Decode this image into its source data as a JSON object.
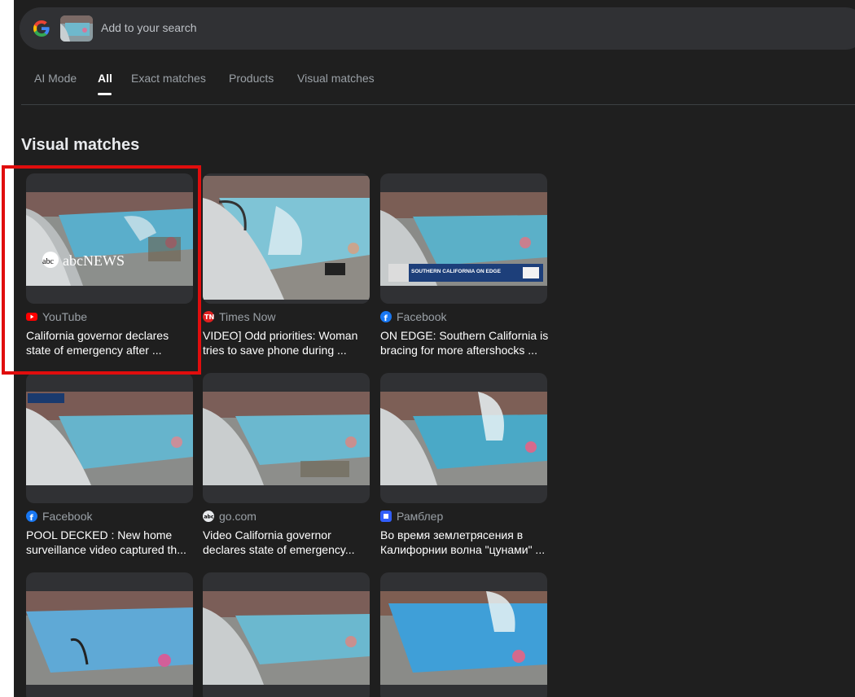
{
  "search": {
    "placeholder": "Add to your search",
    "logo_icon": "google-g-icon",
    "query_image_icon": "pool-thumbnail"
  },
  "tabs": [
    {
      "label": "AI Mode",
      "active": false
    },
    {
      "label": "All",
      "active": true
    },
    {
      "label": "Exact matches",
      "active": false
    },
    {
      "label": "Products",
      "active": false
    },
    {
      "label": "Visual matches",
      "active": false
    }
  ],
  "section": {
    "title": "Visual matches"
  },
  "colors": {
    "background": "#1f1f1f",
    "card": "#303134",
    "highlight": "#e00d0d",
    "youtube": "#ff0000",
    "facebook": "#1877f2"
  },
  "results": [
    {
      "source": "YouTube",
      "source_icon": "youtube-icon",
      "line1": "California governor declares",
      "line2": "state of emergency after ...",
      "overlay": "abcNEWS"
    },
    {
      "source": "Times Now",
      "source_icon": "times-now-icon",
      "line1": "VIDEO] Odd priorities: Woman",
      "line2": "tries to save phone during ..."
    },
    {
      "source": "Facebook",
      "source_icon": "facebook-icon",
      "line1": "ON EDGE: Southern California is",
      "line2": "bracing for more aftershocks ...",
      "banner": "SOUTHERN CALIFORNIA ON EDGE"
    },
    {
      "source": "Facebook",
      "source_icon": "facebook-icon",
      "line1": "POOL DECKED : New home",
      "line2": "surveillance video captured th..."
    },
    {
      "source": "go.com",
      "source_icon": "abc-icon",
      "line1": "Video California governor",
      "line2": "declares state of emergency..."
    },
    {
      "source": "Рамблер",
      "source_icon": "rambler-icon",
      "line1": "Во время землетрясения в",
      "line2": "Калифорнии волна \"цунами\" ..."
    },
    {
      "source": "",
      "source_icon": "",
      "line1": "",
      "line2": ""
    },
    {
      "source": "",
      "source_icon": "",
      "line1": "",
      "line2": ""
    },
    {
      "source": "",
      "source_icon": "",
      "line1": "",
      "line2": ""
    }
  ]
}
